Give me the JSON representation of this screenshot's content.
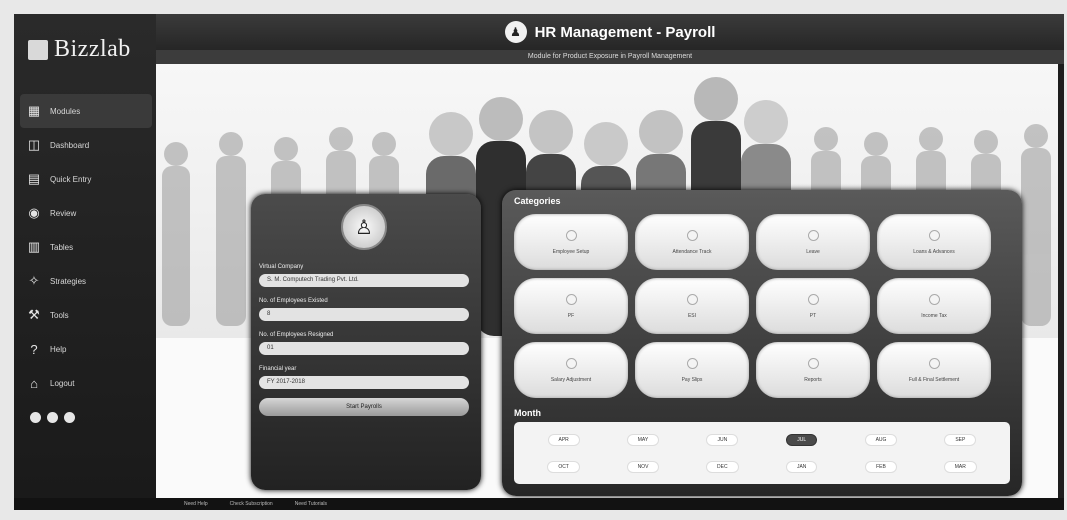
{
  "app": {
    "title": "HR Management - Payroll",
    "subtitle": "Module for Product Exposure in Payroll Management",
    "logo_text": "Bizzlab"
  },
  "sidebar": {
    "items": [
      {
        "label": "Modules",
        "icon": "grid-icon",
        "active": true
      },
      {
        "label": "Dashboard",
        "icon": "dashboard-icon"
      },
      {
        "label": "Quick Entry",
        "icon": "document-icon"
      },
      {
        "label": "Review",
        "icon": "eye-icon"
      },
      {
        "label": "Tables",
        "icon": "table-icon"
      },
      {
        "label": "Strategies",
        "icon": "bulb-icon"
      },
      {
        "label": "Tools",
        "icon": "tools-icon"
      },
      {
        "label": "Help",
        "icon": "help-icon"
      },
      {
        "label": "Logout",
        "icon": "logout-icon"
      }
    ],
    "social": [
      "facebook-icon",
      "twitter-icon",
      "pinterest-icon"
    ]
  },
  "form": {
    "company_label": "Virtual Company",
    "company_value": "S. M. Computech Trading Pvt. Ltd.",
    "employees_label": "No. of Employees Existed",
    "employees_value": "8",
    "resigned_label": "No. of Employees Resigned",
    "resigned_value": "01",
    "year_label": "Financial year",
    "year_value": "FY 2017-2018",
    "start_button": "Start Payrolls"
  },
  "categories": {
    "title": "Categories",
    "items": [
      "Employee Setup",
      "Attendance Track",
      "Leave",
      "Loans & Advances",
      "PF",
      "ESI",
      "PT",
      "Income Tax",
      "Salary Adjustment",
      "Pay Slips",
      "Reports",
      "Full & Final Settlement"
    ]
  },
  "months": {
    "title": "Month",
    "items": [
      "APR",
      "MAY",
      "JUN",
      "JUL",
      "AUG",
      "SEP",
      "OCT",
      "NOV",
      "DEC",
      "JAN",
      "FEB",
      "MAR"
    ],
    "selected": "JUL"
  },
  "footer": {
    "items": [
      "Need Help",
      "Check Subscription",
      "Need Tutorials"
    ]
  },
  "colors": {
    "panel_dark": "#2a2a2a",
    "button_light": "#efefef",
    "sidebar": "#1d1d1d"
  }
}
